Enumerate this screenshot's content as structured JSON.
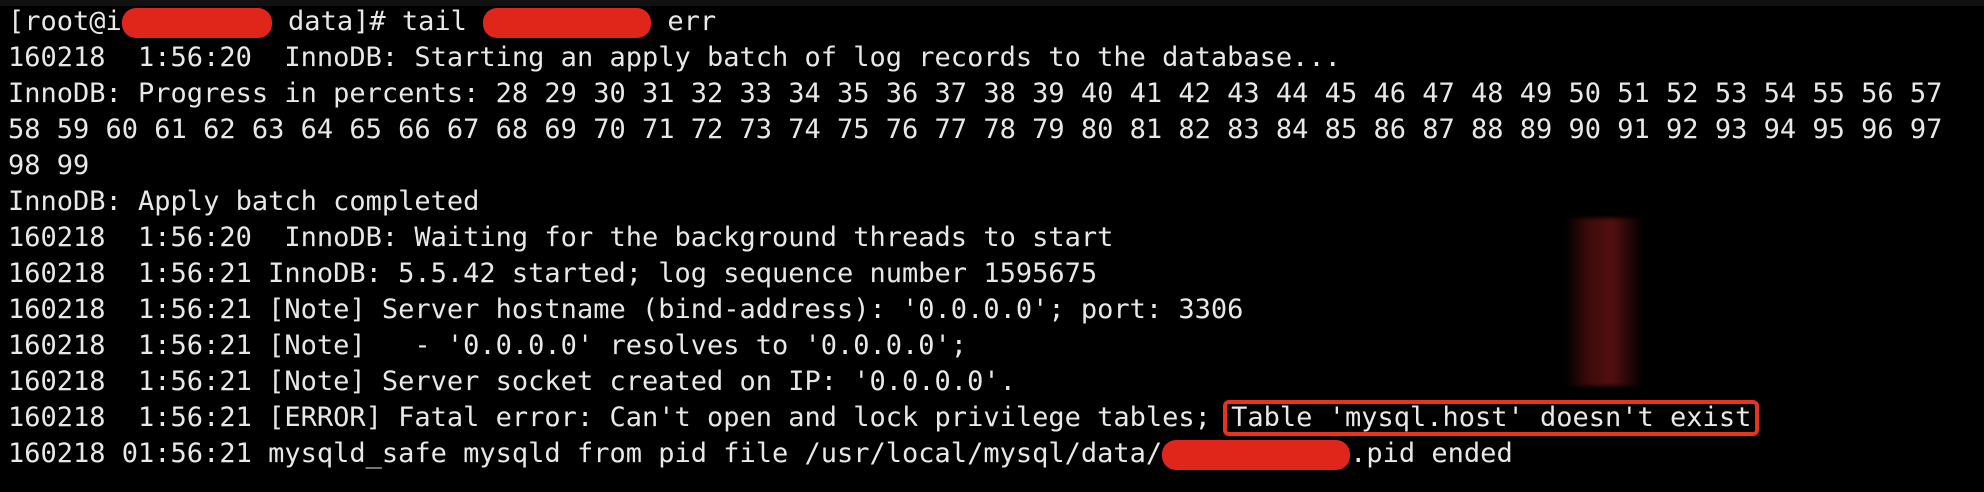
{
  "terminal": {
    "prompt_prefix": "[root@i",
    "prompt_suffix": " data]# tail ",
    "command_suffix": " err",
    "lines": [
      "160218  1:56:20  InnoDB: Starting an apply batch of log records to the database...",
      "InnoDB: Progress in percents: 28 29 30 31 32 33 34 35 36 37 38 39 40 41 42 43 44 45 46 47 48 49 50 51 52 53 54 55 56 57",
      "58 59 60 61 62 63 64 65 66 67 68 69 70 71 72 73 74 75 76 77 78 79 80 81 82 83 84 85 86 87 88 89 90 91 92 93 94 95 96 97",
      "98 99",
      "InnoDB: Apply batch completed",
      "160218  1:56:20  InnoDB: Waiting for the background threads to start",
      "160218  1:56:21 InnoDB: 5.5.42 started; log sequence number 1595675",
      "160218  1:56:21 [Note] Server hostname (bind-address): '0.0.0.0'; port: 3306",
      "160218  1:56:21 [Note]   - '0.0.0.0' resolves to '0.0.0.0';",
      "160218  1:56:21 [Note] Server socket created on IP: '0.0.0.0'."
    ],
    "error_line_prefix": "160218  1:56:21 [ERROR] Fatal error: Can't open and lock privilege tables; ",
    "error_highlight": "Table 'mysql.host' doesn't exist",
    "last_line_prefix": "160218 01:56:21 mysqld_safe mysqld from pid file /usr/local/mysql/data/",
    "last_line_suffix": ".pid ended"
  },
  "colors": {
    "background": "#000000",
    "text": "#e8e8e8",
    "redaction": "#e0261b",
    "highlight_border": "#e8331f"
  }
}
